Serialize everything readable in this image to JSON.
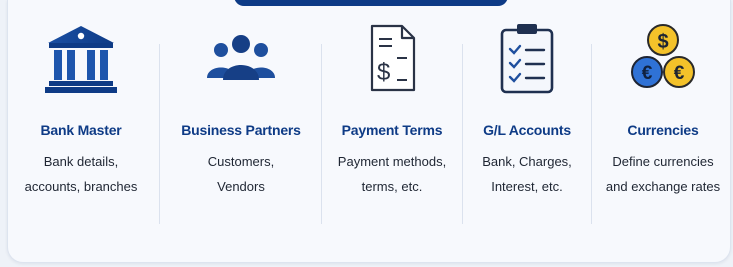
{
  "colors": {
    "brand": "#0e3b86",
    "icon_stroke": "#2a3346",
    "coin_gold": "#f4c22a",
    "coin_blue": "#2f72d6"
  },
  "modules": [
    {
      "icon": "bank-icon",
      "title": "Bank Master",
      "desc_line1": "Bank details,",
      "desc_line2": "accounts, branches"
    },
    {
      "icon": "people-icon",
      "title": "Business Partners",
      "desc_line1": "Customers,",
      "desc_line2": "Vendors"
    },
    {
      "icon": "invoice-icon",
      "title": "Payment Terms",
      "desc_line1": "Payment methods,",
      "desc_line2": "terms, etc."
    },
    {
      "icon": "checklist-icon",
      "title": "G/L Accounts",
      "desc_line1": "Bank, Charges,",
      "desc_line2": "Interest, etc."
    },
    {
      "icon": "coins-icon",
      "title": "Currencies",
      "desc_line1": "Define currencies",
      "desc_line2": "and exchange rates"
    },
    {
      "icon_symbols": {
        "dollar": "$",
        "euro": "€"
      }
    }
  ]
}
